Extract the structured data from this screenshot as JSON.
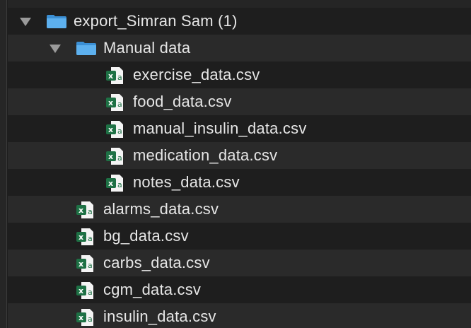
{
  "tree": {
    "partial_top_label": "",
    "root_folder": {
      "label": "export_Simran Sam (1)",
      "expanded": true
    },
    "sub_folder": {
      "label": "Manual data",
      "expanded": true
    },
    "sub_files": [
      {
        "label": "exercise_data.csv",
        "icon": "excel-csv-icon"
      },
      {
        "label": "food_data.csv",
        "icon": "excel-csv-icon"
      },
      {
        "label": "manual_insulin_data.csv",
        "icon": "excel-csv-icon"
      },
      {
        "label": "medication_data.csv",
        "icon": "excel-csv-icon"
      },
      {
        "label": "notes_data.csv",
        "icon": "excel-csv-icon"
      }
    ],
    "root_files": [
      {
        "label": "alarms_data.csv",
        "icon": "excel-csv-icon"
      },
      {
        "label": "bg_data.csv",
        "icon": "excel-csv-icon"
      },
      {
        "label": "carbs_data.csv",
        "icon": "excel-csv-icon"
      },
      {
        "label": "cgm_data.csv",
        "icon": "excel-csv-icon"
      },
      {
        "label": "insulin_data.csv",
        "icon": "excel-csv-icon"
      }
    ]
  },
  "colors": {
    "background": "#1e1e1e",
    "row_alt": "#2a2a2a",
    "text": "#e6e6e6",
    "folder_blue": "#4fa3e0",
    "excel_green": "#1e7145"
  }
}
